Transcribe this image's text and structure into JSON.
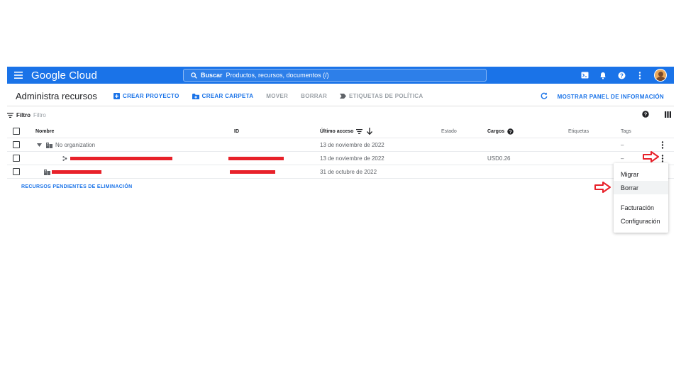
{
  "topbar": {
    "brand": "Google Cloud",
    "search_label": "Buscar",
    "search_placeholder": "Productos, recursos, documentos (/)",
    "color": "#1a73e8"
  },
  "actions": {
    "title": "Administra recursos",
    "create_project": "CREAR PROYECTO",
    "create_folder": "CREAR CARPETA",
    "move": "MOVER",
    "delete": "BORRAR",
    "policy_tags": "ETIQUETAS DE POLÍTICA",
    "show_info_panel": "MOSTRAR PANEL DE INFORMACIÓN"
  },
  "filter": {
    "label": "Filtro",
    "placeholder": "Filtro"
  },
  "table": {
    "columns": {
      "name": "Nombre",
      "id": "ID",
      "last_access": "Último acceso",
      "status": "Estado",
      "charges": "Cargos",
      "labels": "Etiquetas",
      "tags": "Tags"
    },
    "rows": [
      {
        "name": "No organization",
        "last_access": "13 de noviembre de 2022",
        "charges": "",
        "tags": "–"
      },
      {
        "name": "",
        "last_access": "13 de noviembre de 2022",
        "charges": "USD0.26",
        "tags": "–"
      },
      {
        "name": "",
        "last_access": "31 de octubre de 2022",
        "charges": "",
        "tags": ""
      }
    ]
  },
  "pending_link": "RECURSOS PENDIENTES DE ELIMINACIÓN",
  "context_menu": {
    "items": [
      "Migrar",
      "Borrar",
      "Facturación",
      "Configuración"
    ]
  },
  "colors": {
    "accent": "#1a73e8",
    "redaction": "#e8212a",
    "annotation_arrow": "#e8212a"
  }
}
